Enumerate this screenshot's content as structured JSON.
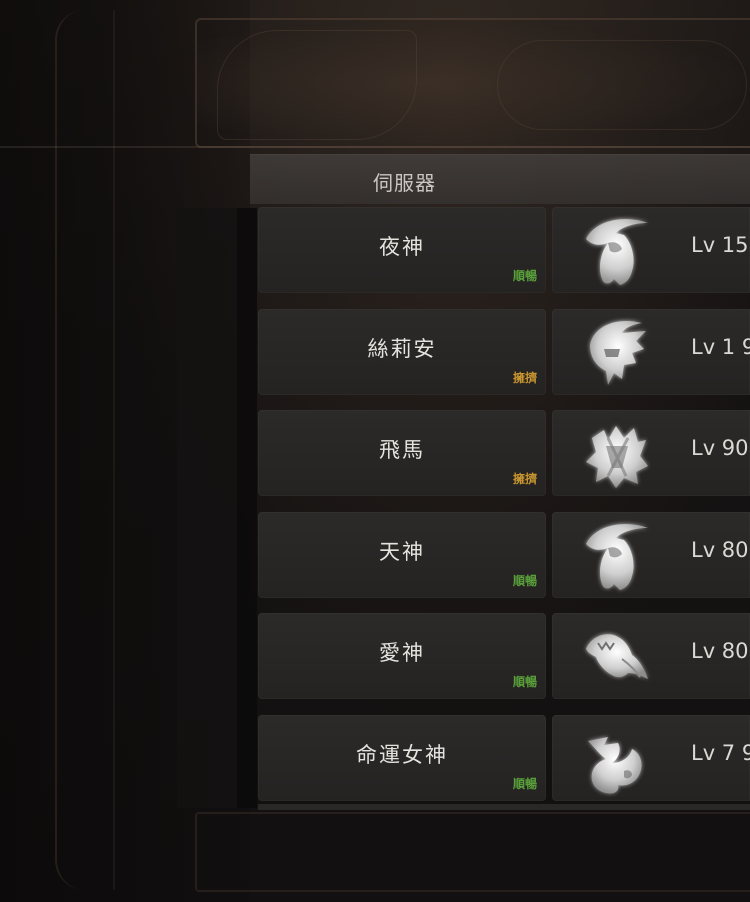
{
  "panel": {
    "header": "伺服器"
  },
  "colors": {
    "status_smooth": "#5aa03a",
    "status_crowded": "#c8952f"
  },
  "rows": [
    {
      "server": "夜神",
      "status": "順暢",
      "status_type": "smooth",
      "class_icon": "scythe-hood-icon",
      "level": "Lv 15"
    },
    {
      "server": "絲莉安",
      "status": "擁擠",
      "status_type": "crowded",
      "class_icon": "plumed-helmet-icon",
      "level": "Lv 1 9"
    },
    {
      "server": "飛馬",
      "status": "擁擠",
      "status_type": "crowded",
      "class_icon": "thorn-crest-icon",
      "level": "Lv 90"
    },
    {
      "server": "天神",
      "status": "順暢",
      "status_type": "smooth",
      "class_icon": "scythe-hood-icon",
      "level": "Lv 80"
    },
    {
      "server": "愛神",
      "status": "順暢",
      "status_type": "smooth",
      "class_icon": "winged-beast-icon",
      "level": "Lv 80"
    },
    {
      "server": "命運女神",
      "status": "順暢",
      "status_type": "smooth",
      "class_icon": "flame-spirit-icon",
      "level": "Lv 7 9"
    }
  ]
}
